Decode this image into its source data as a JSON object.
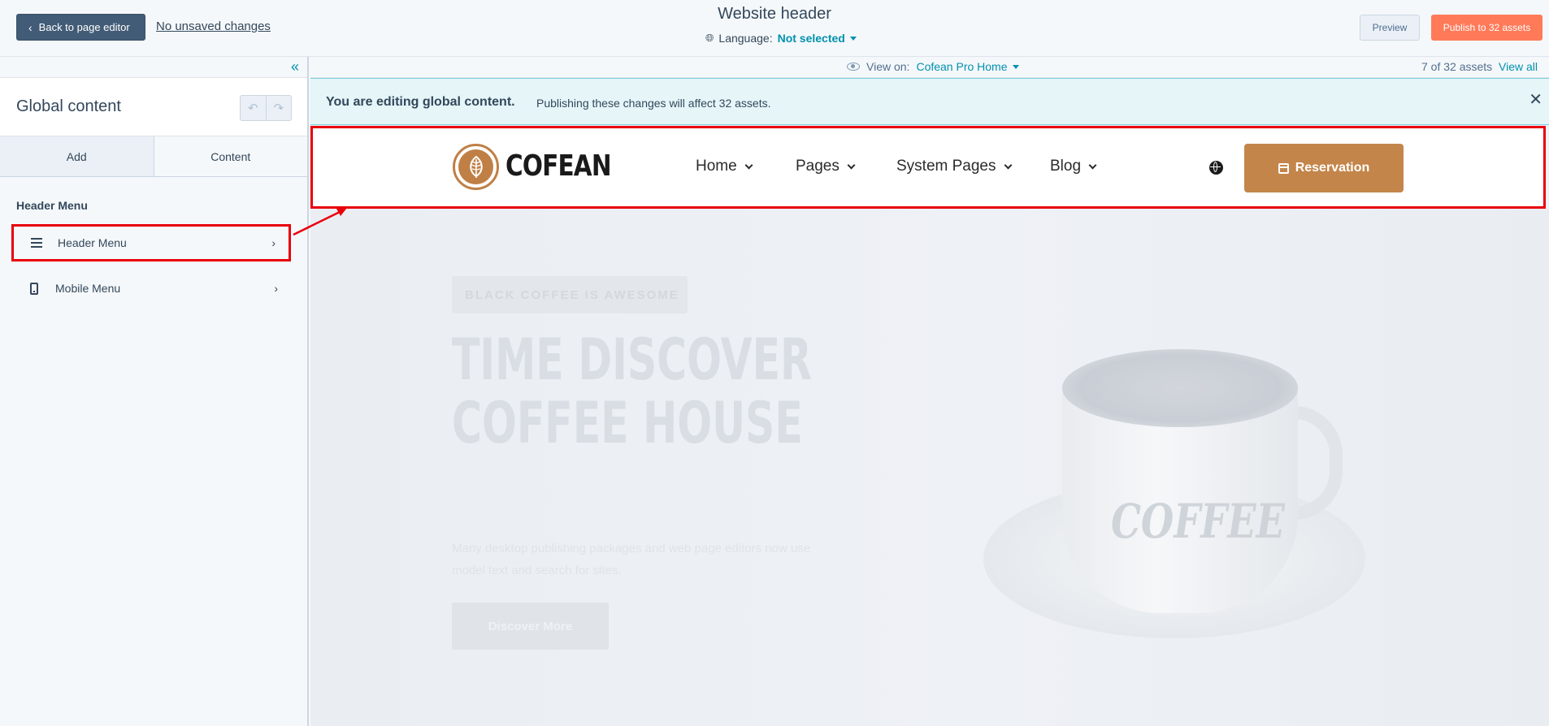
{
  "topbar": {
    "back_label": "Back to page editor",
    "unsaved_label": "No unsaved changes",
    "title": "Website header",
    "language_label": "Language:",
    "language_value": "Not selected",
    "preview_label": "Preview",
    "publish_label": "Publish to 32 assets"
  },
  "sidebar": {
    "title": "Global content",
    "tabs": [
      {
        "label": "Add"
      },
      {
        "label": "Content"
      }
    ],
    "section_label": "Header Menu",
    "items": [
      {
        "label": "Header Menu",
        "icon": "hamburger-menu-icon"
      },
      {
        "label": "Mobile Menu",
        "icon": "mobile-phone-icon"
      }
    ]
  },
  "viewbar": {
    "view_on_label": "View on:",
    "view_on_value": "Cofean Pro Home",
    "assets_count": "7 of 32 assets",
    "view_all": "View all"
  },
  "banner": {
    "strong": "You are editing global content.",
    "text": "Publishing these changes will affect 32 assets."
  },
  "site_header": {
    "logo_text": "COFEAN",
    "nav": [
      {
        "label": "Home"
      },
      {
        "label": "Pages"
      },
      {
        "label": "System Pages"
      },
      {
        "label": "Blog"
      }
    ],
    "cta_label": "Reservation"
  },
  "hero": {
    "tag": "BLACK COFFEE IS AWESOME",
    "title_line1": "TIME DISCOVER",
    "title_line2": "COFFEE HOUSE",
    "description": "Many desktop publishing packages and web page editors now use model text and search for sites.",
    "button": "Discover More",
    "cup_label": "COFFEE"
  },
  "colors": {
    "brand_dark": "#425b76",
    "publish": "#ff7a59",
    "link": "#0091ae",
    "annotation_red": "#e8000b",
    "coffee_accent": "#c4854a"
  }
}
